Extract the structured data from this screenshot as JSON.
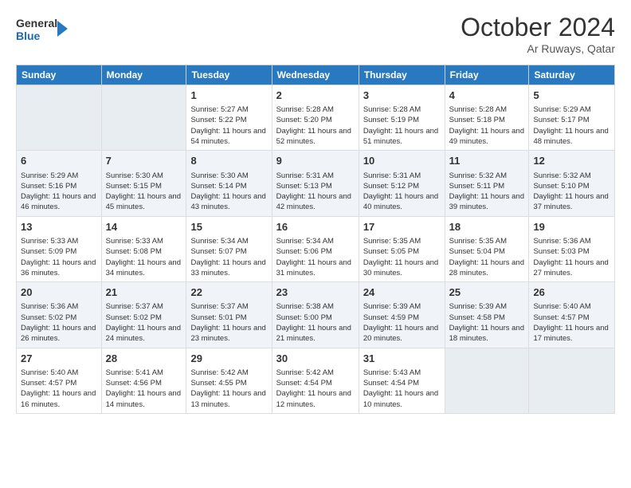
{
  "header": {
    "logo_line1": "General",
    "logo_line2": "Blue",
    "month": "October 2024",
    "location": "Ar Ruways, Qatar"
  },
  "days_of_week": [
    "Sunday",
    "Monday",
    "Tuesday",
    "Wednesday",
    "Thursday",
    "Friday",
    "Saturday"
  ],
  "weeks": [
    [
      {
        "day": "",
        "empty": true
      },
      {
        "day": "",
        "empty": true
      },
      {
        "day": "1",
        "sunrise": "5:27 AM",
        "sunset": "5:22 PM",
        "daylight": "11 hours and 54 minutes."
      },
      {
        "day": "2",
        "sunrise": "5:28 AM",
        "sunset": "5:20 PM",
        "daylight": "11 hours and 52 minutes."
      },
      {
        "day": "3",
        "sunrise": "5:28 AM",
        "sunset": "5:19 PM",
        "daylight": "11 hours and 51 minutes."
      },
      {
        "day": "4",
        "sunrise": "5:28 AM",
        "sunset": "5:18 PM",
        "daylight": "11 hours and 49 minutes."
      },
      {
        "day": "5",
        "sunrise": "5:29 AM",
        "sunset": "5:17 PM",
        "daylight": "11 hours and 48 minutes."
      }
    ],
    [
      {
        "day": "6",
        "sunrise": "5:29 AM",
        "sunset": "5:16 PM",
        "daylight": "11 hours and 46 minutes."
      },
      {
        "day": "7",
        "sunrise": "5:30 AM",
        "sunset": "5:15 PM",
        "daylight": "11 hours and 45 minutes."
      },
      {
        "day": "8",
        "sunrise": "5:30 AM",
        "sunset": "5:14 PM",
        "daylight": "11 hours and 43 minutes."
      },
      {
        "day": "9",
        "sunrise": "5:31 AM",
        "sunset": "5:13 PM",
        "daylight": "11 hours and 42 minutes."
      },
      {
        "day": "10",
        "sunrise": "5:31 AM",
        "sunset": "5:12 PM",
        "daylight": "11 hours and 40 minutes."
      },
      {
        "day": "11",
        "sunrise": "5:32 AM",
        "sunset": "5:11 PM",
        "daylight": "11 hours and 39 minutes."
      },
      {
        "day": "12",
        "sunrise": "5:32 AM",
        "sunset": "5:10 PM",
        "daylight": "11 hours and 37 minutes."
      }
    ],
    [
      {
        "day": "13",
        "sunrise": "5:33 AM",
        "sunset": "5:09 PM",
        "daylight": "11 hours and 36 minutes."
      },
      {
        "day": "14",
        "sunrise": "5:33 AM",
        "sunset": "5:08 PM",
        "daylight": "11 hours and 34 minutes."
      },
      {
        "day": "15",
        "sunrise": "5:34 AM",
        "sunset": "5:07 PM",
        "daylight": "11 hours and 33 minutes."
      },
      {
        "day": "16",
        "sunrise": "5:34 AM",
        "sunset": "5:06 PM",
        "daylight": "11 hours and 31 minutes."
      },
      {
        "day": "17",
        "sunrise": "5:35 AM",
        "sunset": "5:05 PM",
        "daylight": "11 hours and 30 minutes."
      },
      {
        "day": "18",
        "sunrise": "5:35 AM",
        "sunset": "5:04 PM",
        "daylight": "11 hours and 28 minutes."
      },
      {
        "day": "19",
        "sunrise": "5:36 AM",
        "sunset": "5:03 PM",
        "daylight": "11 hours and 27 minutes."
      }
    ],
    [
      {
        "day": "20",
        "sunrise": "5:36 AM",
        "sunset": "5:02 PM",
        "daylight": "11 hours and 26 minutes."
      },
      {
        "day": "21",
        "sunrise": "5:37 AM",
        "sunset": "5:02 PM",
        "daylight": "11 hours and 24 minutes."
      },
      {
        "day": "22",
        "sunrise": "5:37 AM",
        "sunset": "5:01 PM",
        "daylight": "11 hours and 23 minutes."
      },
      {
        "day": "23",
        "sunrise": "5:38 AM",
        "sunset": "5:00 PM",
        "daylight": "11 hours and 21 minutes."
      },
      {
        "day": "24",
        "sunrise": "5:39 AM",
        "sunset": "4:59 PM",
        "daylight": "11 hours and 20 minutes."
      },
      {
        "day": "25",
        "sunrise": "5:39 AM",
        "sunset": "4:58 PM",
        "daylight": "11 hours and 18 minutes."
      },
      {
        "day": "26",
        "sunrise": "5:40 AM",
        "sunset": "4:57 PM",
        "daylight": "11 hours and 17 minutes."
      }
    ],
    [
      {
        "day": "27",
        "sunrise": "5:40 AM",
        "sunset": "4:57 PM",
        "daylight": "11 hours and 16 minutes."
      },
      {
        "day": "28",
        "sunrise": "5:41 AM",
        "sunset": "4:56 PM",
        "daylight": "11 hours and 14 minutes."
      },
      {
        "day": "29",
        "sunrise": "5:42 AM",
        "sunset": "4:55 PM",
        "daylight": "11 hours and 13 minutes."
      },
      {
        "day": "30",
        "sunrise": "5:42 AM",
        "sunset": "4:54 PM",
        "daylight": "11 hours and 12 minutes."
      },
      {
        "day": "31",
        "sunrise": "5:43 AM",
        "sunset": "4:54 PM",
        "daylight": "11 hours and 10 minutes."
      },
      {
        "day": "",
        "empty": true
      },
      {
        "day": "",
        "empty": true
      }
    ]
  ],
  "labels": {
    "sunrise_prefix": "Sunrise: ",
    "sunset_prefix": "Sunset: ",
    "daylight_prefix": "Daylight: "
  }
}
